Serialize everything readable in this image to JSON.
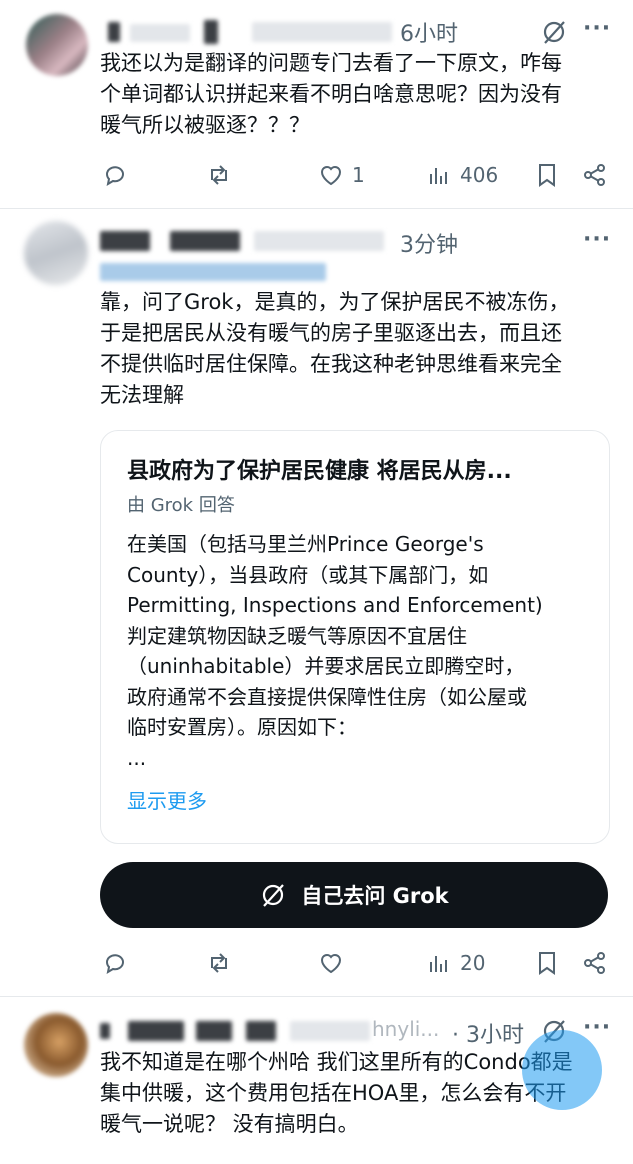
{
  "colors": {
    "text": "#0f1419",
    "muted": "#536471",
    "link": "#1d9bf0",
    "button_bg": "#0f1419"
  },
  "post1": {
    "time": "6小时",
    "text_lines": [
      "我还以为是翻译的问题专门去看了一下原文，咋每",
      "个单词都认识拼起来看不明白啥意思呢？因为没有",
      "暖气所以被驱逐？？？"
    ],
    "actions": {
      "reply": "",
      "retweet": "",
      "like": "1",
      "views": "406"
    }
  },
  "post2": {
    "time": "3分钟",
    "text_lines": [
      "靠，问了Grok，是真的，为了保护居民不被冻伤，",
      "于是把居民从没有暖气的房子里驱逐出去，而且还",
      "不提供临时居住保障。在我这种老钟思维看来完全",
      "无法理解"
    ],
    "card": {
      "title": "县政府为了保护居民健康 将居民从房...",
      "subtitle": "由 Grok 回答",
      "body_lines": [
        "在美国（包括马里兰州Prince George's",
        "County），当县政府（或其下属部门，如",
        "Permitting, Inspections and Enforcement)",
        "判定建筑物因缺乏暖气等原因不宜居住",
        "（uninhabitable）并要求居民立即腾空时，",
        "政府通常不会直接提供保障性住房（如公屋或",
        "临时安置房）。原因如下：",
        "..."
      ],
      "show_more": "显示更多"
    },
    "grok_button": "自己去问 Grok",
    "actions": {
      "reply": "",
      "retweet": "",
      "like": "",
      "views": "20"
    }
  },
  "post3": {
    "handle_fragment": "hnyli...",
    "time": "· 3小时",
    "text_lines": [
      "我不知道是在哪个州哈 我们这里所有的Condo都是",
      "集中供暖，这个费用包括在HOA里，怎么会有不开",
      "暖气一说呢？ 没有搞明白。"
    ]
  },
  "icons": {
    "more": "more-icon",
    "grok": "grok-icon",
    "reply": "reply-icon",
    "retweet": "retweet-icon",
    "like": "heart-icon",
    "views": "views-icon",
    "bookmark": "bookmark-icon",
    "share": "share-icon"
  }
}
